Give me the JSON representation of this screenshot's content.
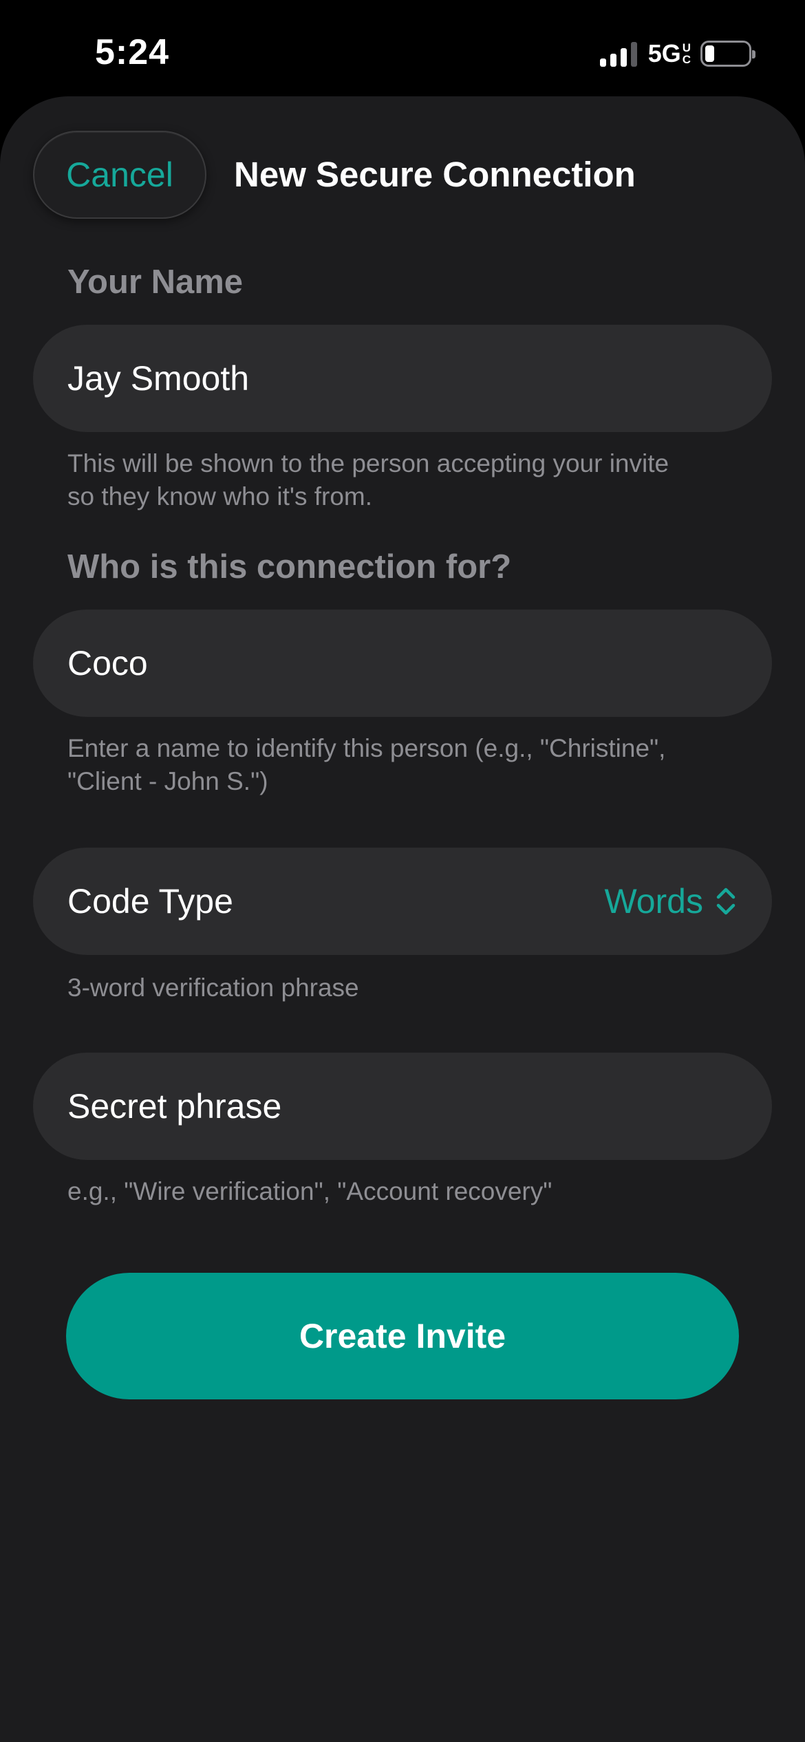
{
  "status_bar": {
    "time": "5:24",
    "network": "5G",
    "network_badge_top": "U",
    "network_badge_bottom": "C"
  },
  "header": {
    "cancel_label": "Cancel",
    "title": "New Secure Connection"
  },
  "your_name": {
    "label": "Your Name",
    "value": "Jay Smooth",
    "helper_line1": "This will be shown to the person accepting your invite",
    "helper_line2": "so they know who it's from."
  },
  "recipient": {
    "label": "Who is this connection for?",
    "value": "Coco",
    "helper_line1": "Enter a name to identify this person (e.g., \"Christine\",",
    "helper_line2": "\"Client - John S.\")"
  },
  "code_type": {
    "label": "Code Type",
    "value": "Words",
    "helper": "3-word verification phrase"
  },
  "secret_phrase": {
    "placeholder": "Secret phrase",
    "helper": "e.g., \"Wire verification\", \"Account recovery\""
  },
  "actions": {
    "create_invite_label": "Create Invite"
  },
  "colors": {
    "accent": "#16a89a",
    "button": "#009a8a",
    "sheet_background": "#1c1c1e",
    "field_background": "#2c2c2e",
    "secondary_text": "#8e8e93"
  },
  "icons": {
    "code_type_chevron": "chevron-up-down-icon"
  }
}
